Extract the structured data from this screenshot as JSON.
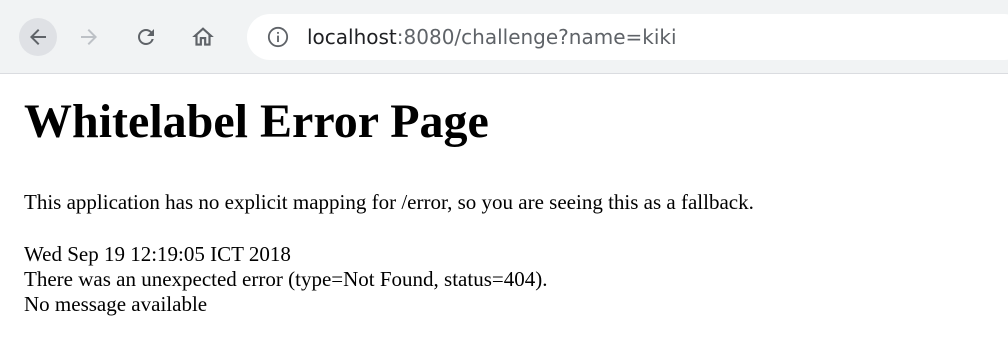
{
  "browser": {
    "url_host": "localhost",
    "url_rest": ":8080/challenge?name=kiki",
    "icons": {
      "back": "arrow-left-icon",
      "forward": "arrow-right-icon",
      "reload": "reload-icon",
      "home": "home-icon",
      "site_info": "info-icon"
    }
  },
  "page": {
    "title": "Whitelabel Error Page",
    "description": "This application has no explicit mapping for /error, so you are seeing this as a fallback.",
    "timestamp": "Wed Sep 19 12:19:05 ICT 2018",
    "error_line": "There was an unexpected error (type=Not Found, status=404).",
    "message_line": "No message available"
  },
  "colors": {
    "toolbar_bg": "#f1f3f4",
    "active_icon": "#5f6368",
    "disabled_icon": "#bdc1c6",
    "text": "#000000"
  }
}
